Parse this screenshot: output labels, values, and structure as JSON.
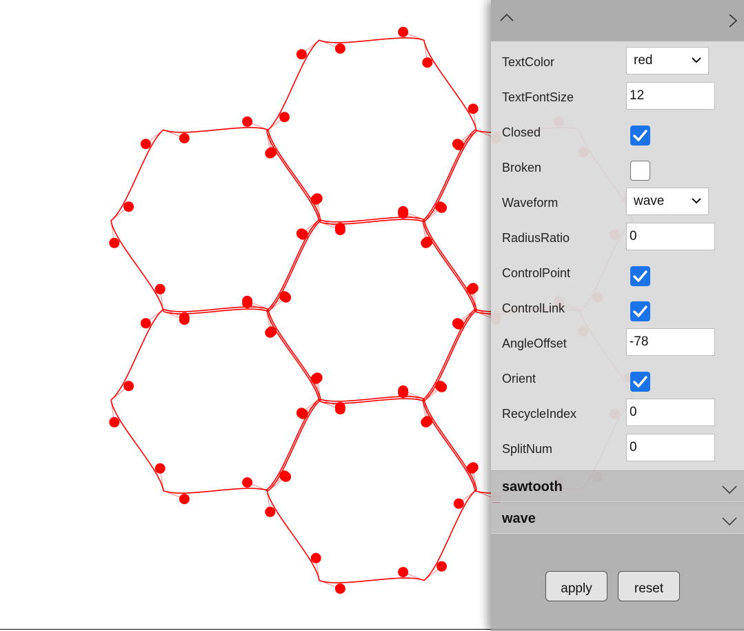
{
  "panel": {
    "properties": [
      {
        "label": "TextColor",
        "type": "select",
        "value": "red"
      },
      {
        "label": "TextFontSize",
        "type": "input",
        "value": "12"
      },
      {
        "label": "Closed",
        "type": "checkbox",
        "checked": true
      },
      {
        "label": "Broken",
        "type": "checkbox",
        "checked": false
      },
      {
        "label": "Waveform",
        "type": "select",
        "value": "wave"
      },
      {
        "label": "RadiusRatio",
        "type": "input",
        "value": "0"
      },
      {
        "label": "ControlPoint",
        "type": "checkbox",
        "checked": true
      },
      {
        "label": "ControlLink",
        "type": "checkbox",
        "checked": true
      },
      {
        "label": "AngleOffset",
        "type": "input",
        "value": "-78"
      },
      {
        "label": "Orient",
        "type": "checkbox",
        "checked": true
      },
      {
        "label": "RecycleIndex",
        "type": "input",
        "value": "0"
      },
      {
        "label": "SplitNum",
        "type": "input",
        "value": "0"
      }
    ],
    "sections": [
      {
        "title": "sawtooth"
      },
      {
        "title": "wave"
      }
    ],
    "buttons": {
      "apply": "apply",
      "reset": "reset"
    }
  },
  "icons": {
    "collapse": "chevron-up-icon",
    "expand": "chevron-right-icon",
    "section_toggle": "chevron-down-icon",
    "checkmark": "checkmark-icon"
  },
  "colors": {
    "stroke": "#ff0000",
    "point": "#ff0000",
    "checkbox_on": "#1a73e8",
    "panel_bg": "#a0a0a0"
  }
}
